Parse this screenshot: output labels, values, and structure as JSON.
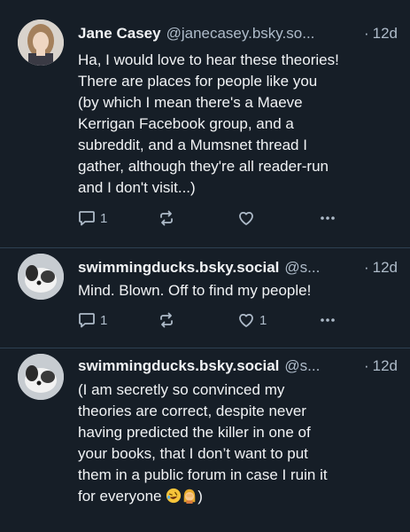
{
  "posts": [
    {
      "author_name": "Jane Casey",
      "handle": "@janecasey.bsky.so...",
      "separator": "·",
      "time": "12d",
      "text": "Ha, I would love to hear these theories!\nThere are places for people like you\n(by which I mean there's a Maeve\nKerrigan Facebook group, and a\nsubreddit, and a Mumsnet thread I\ngather, although they're all reader-run\nand I don't visit...)",
      "reply_count": "1",
      "like_count": "",
      "avatar_icon": "woman-photo-avatar"
    },
    {
      "author_name": "swimmingducks.bsky.social",
      "handle": "@s...",
      "separator": "·",
      "time": "12d",
      "text": "Mind. Blown. Off to find my people!",
      "reply_count": "1",
      "like_count": "1",
      "avatar_icon": "dog-photo-avatar"
    },
    {
      "author_name": "swimmingducks.bsky.social",
      "handle": "@s...",
      "separator": "·",
      "time": "12d",
      "text": "(I am secretly so convinced my\ntheories are correct, despite never\nhaving predicted the killer in one of\nyour books, that I don’t want to put\nthem in a public forum in case I ruin it\nfor everyone",
      "text_end": ")",
      "avatar_icon": "dog-photo-avatar"
    }
  ],
  "icons": {
    "reply": "speech-bubble-icon",
    "repost": "repost-arrows-icon",
    "like": "heart-icon",
    "more": "ellipsis-icon",
    "emoji_1": "rolling-laughing-emoji",
    "emoji_2": "facepalm-woman-emoji"
  },
  "colors": {
    "background": "#161e27",
    "text": "#f1f3f5",
    "muted": "#aebbc9",
    "divider": "#2e4052"
  }
}
